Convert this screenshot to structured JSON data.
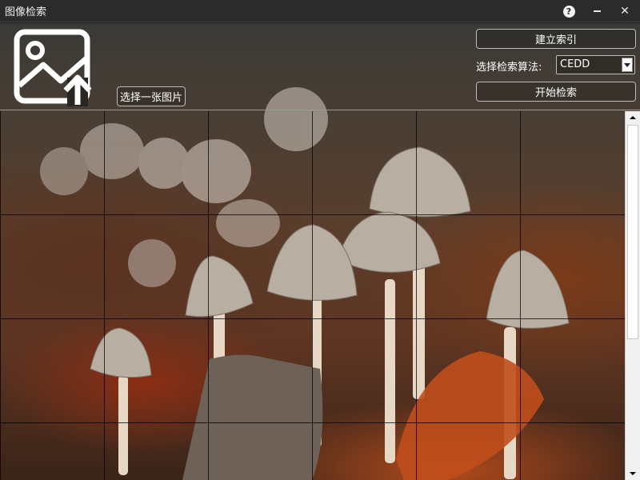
{
  "window": {
    "title": "图像检索",
    "help_glyph": "?",
    "minimize_glyph": "—",
    "close_glyph": "✕"
  },
  "header": {
    "upload_icon": "image-upload-icon",
    "choose_image_label": "选择一张图片",
    "build_index_label": "建立索引",
    "algorithm_label": "选择检索算法:",
    "algorithm_selected": "CEDD",
    "start_search_label": "开始检索"
  },
  "results_grid": {
    "columns": 6,
    "rows": 4
  },
  "colors": {
    "titlebar": "#2b2b2b",
    "border": "#bdbdbd",
    "text": "#ffffff"
  }
}
